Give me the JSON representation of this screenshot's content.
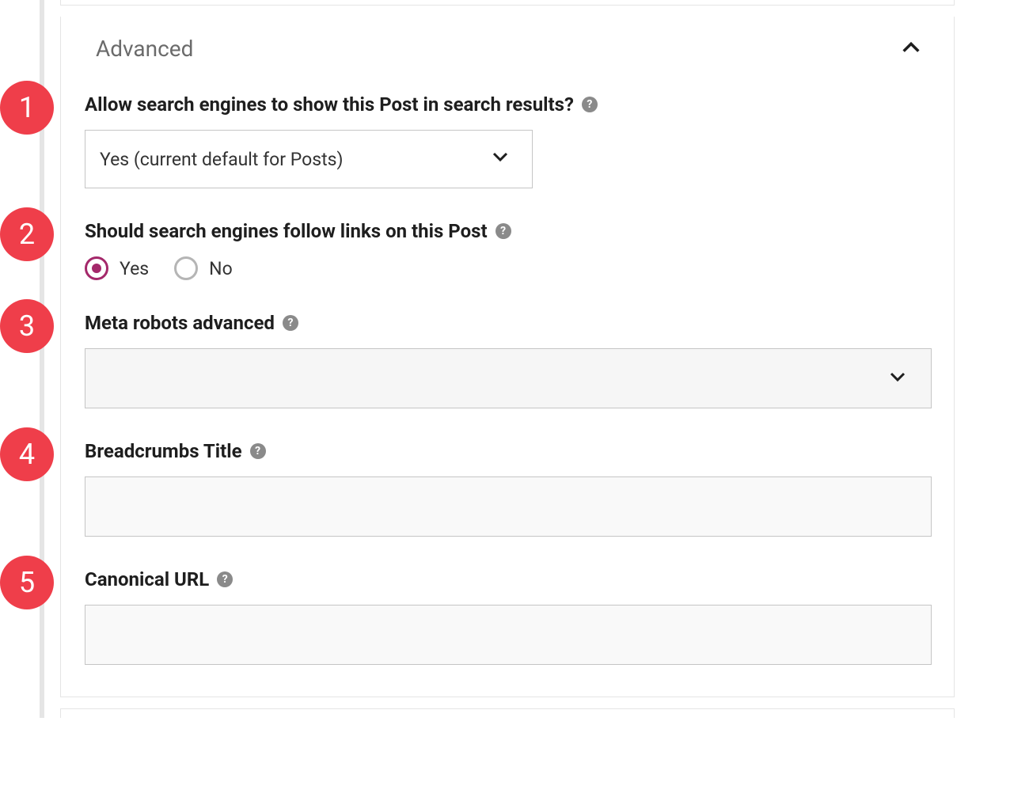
{
  "panel": {
    "title": "Advanced"
  },
  "annotations": {
    "n1": "1",
    "n2": "2",
    "n3": "3",
    "n4": "4",
    "n5": "5"
  },
  "fields": {
    "allow_search": {
      "label": "Allow search engines to show this Post in search results?",
      "value": "Yes (current default for Posts)"
    },
    "follow_links": {
      "label": "Should search engines follow links on this Post",
      "options": {
        "yes": "Yes",
        "no": "No"
      },
      "selected": "yes"
    },
    "meta_robots": {
      "label": "Meta robots advanced",
      "value": ""
    },
    "breadcrumbs": {
      "label": "Breadcrumbs Title",
      "value": ""
    },
    "canonical": {
      "label": "Canonical URL",
      "value": ""
    }
  },
  "help_glyph": "?"
}
